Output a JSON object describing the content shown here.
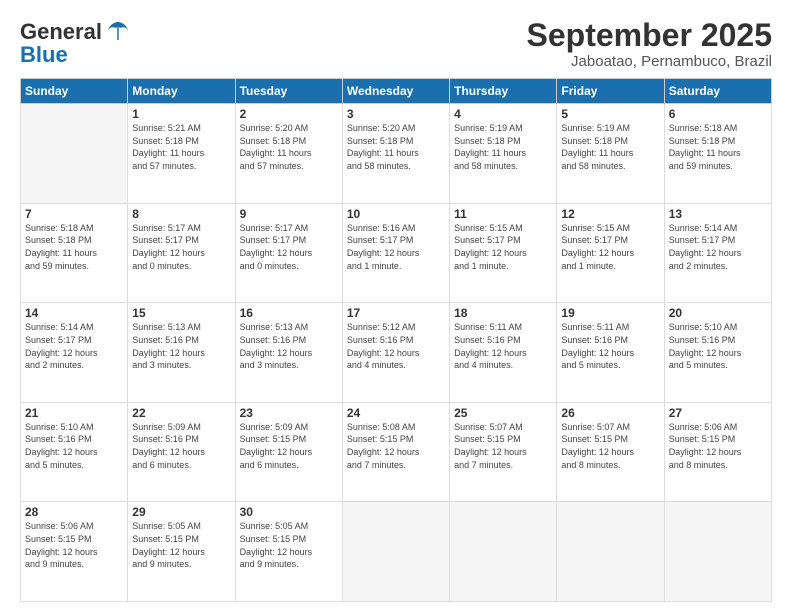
{
  "logo": {
    "line1": "General",
    "line2": "Blue"
  },
  "title": "September 2025",
  "subtitle": "Jaboatao, Pernambuco, Brazil",
  "days": [
    "Sunday",
    "Monday",
    "Tuesday",
    "Wednesday",
    "Thursday",
    "Friday",
    "Saturday"
  ],
  "weeks": [
    [
      {
        "num": "",
        "info": ""
      },
      {
        "num": "1",
        "info": "Sunrise: 5:21 AM\nSunset: 5:18 PM\nDaylight: 11 hours\nand 57 minutes."
      },
      {
        "num": "2",
        "info": "Sunrise: 5:20 AM\nSunset: 5:18 PM\nDaylight: 11 hours\nand 57 minutes."
      },
      {
        "num": "3",
        "info": "Sunrise: 5:20 AM\nSunset: 5:18 PM\nDaylight: 11 hours\nand 58 minutes."
      },
      {
        "num": "4",
        "info": "Sunrise: 5:19 AM\nSunset: 5:18 PM\nDaylight: 11 hours\nand 58 minutes."
      },
      {
        "num": "5",
        "info": "Sunrise: 5:19 AM\nSunset: 5:18 PM\nDaylight: 11 hours\nand 58 minutes."
      },
      {
        "num": "6",
        "info": "Sunrise: 5:18 AM\nSunset: 5:18 PM\nDaylight: 11 hours\nand 59 minutes."
      }
    ],
    [
      {
        "num": "7",
        "info": "Sunrise: 5:18 AM\nSunset: 5:18 PM\nDaylight: 11 hours\nand 59 minutes."
      },
      {
        "num": "8",
        "info": "Sunrise: 5:17 AM\nSunset: 5:17 PM\nDaylight: 12 hours\nand 0 minutes."
      },
      {
        "num": "9",
        "info": "Sunrise: 5:17 AM\nSunset: 5:17 PM\nDaylight: 12 hours\nand 0 minutes."
      },
      {
        "num": "10",
        "info": "Sunrise: 5:16 AM\nSunset: 5:17 PM\nDaylight: 12 hours\nand 1 minute."
      },
      {
        "num": "11",
        "info": "Sunrise: 5:15 AM\nSunset: 5:17 PM\nDaylight: 12 hours\nand 1 minute."
      },
      {
        "num": "12",
        "info": "Sunrise: 5:15 AM\nSunset: 5:17 PM\nDaylight: 12 hours\nand 1 minute."
      },
      {
        "num": "13",
        "info": "Sunrise: 5:14 AM\nSunset: 5:17 PM\nDaylight: 12 hours\nand 2 minutes."
      }
    ],
    [
      {
        "num": "14",
        "info": "Sunrise: 5:14 AM\nSunset: 5:17 PM\nDaylight: 12 hours\nand 2 minutes."
      },
      {
        "num": "15",
        "info": "Sunrise: 5:13 AM\nSunset: 5:16 PM\nDaylight: 12 hours\nand 3 minutes."
      },
      {
        "num": "16",
        "info": "Sunrise: 5:13 AM\nSunset: 5:16 PM\nDaylight: 12 hours\nand 3 minutes."
      },
      {
        "num": "17",
        "info": "Sunrise: 5:12 AM\nSunset: 5:16 PM\nDaylight: 12 hours\nand 4 minutes."
      },
      {
        "num": "18",
        "info": "Sunrise: 5:11 AM\nSunset: 5:16 PM\nDaylight: 12 hours\nand 4 minutes."
      },
      {
        "num": "19",
        "info": "Sunrise: 5:11 AM\nSunset: 5:16 PM\nDaylight: 12 hours\nand 5 minutes."
      },
      {
        "num": "20",
        "info": "Sunrise: 5:10 AM\nSunset: 5:16 PM\nDaylight: 12 hours\nand 5 minutes."
      }
    ],
    [
      {
        "num": "21",
        "info": "Sunrise: 5:10 AM\nSunset: 5:16 PM\nDaylight: 12 hours\nand 5 minutes."
      },
      {
        "num": "22",
        "info": "Sunrise: 5:09 AM\nSunset: 5:16 PM\nDaylight: 12 hours\nand 6 minutes."
      },
      {
        "num": "23",
        "info": "Sunrise: 5:09 AM\nSunset: 5:15 PM\nDaylight: 12 hours\nand 6 minutes."
      },
      {
        "num": "24",
        "info": "Sunrise: 5:08 AM\nSunset: 5:15 PM\nDaylight: 12 hours\nand 7 minutes."
      },
      {
        "num": "25",
        "info": "Sunrise: 5:07 AM\nSunset: 5:15 PM\nDaylight: 12 hours\nand 7 minutes."
      },
      {
        "num": "26",
        "info": "Sunrise: 5:07 AM\nSunset: 5:15 PM\nDaylight: 12 hours\nand 8 minutes."
      },
      {
        "num": "27",
        "info": "Sunrise: 5:06 AM\nSunset: 5:15 PM\nDaylight: 12 hours\nand 8 minutes."
      }
    ],
    [
      {
        "num": "28",
        "info": "Sunrise: 5:06 AM\nSunset: 5:15 PM\nDaylight: 12 hours\nand 9 minutes."
      },
      {
        "num": "29",
        "info": "Sunrise: 5:05 AM\nSunset: 5:15 PM\nDaylight: 12 hours\nand 9 minutes."
      },
      {
        "num": "30",
        "info": "Sunrise: 5:05 AM\nSunset: 5:15 PM\nDaylight: 12 hours\nand 9 minutes."
      },
      {
        "num": "",
        "info": ""
      },
      {
        "num": "",
        "info": ""
      },
      {
        "num": "",
        "info": ""
      },
      {
        "num": "",
        "info": ""
      }
    ]
  ]
}
